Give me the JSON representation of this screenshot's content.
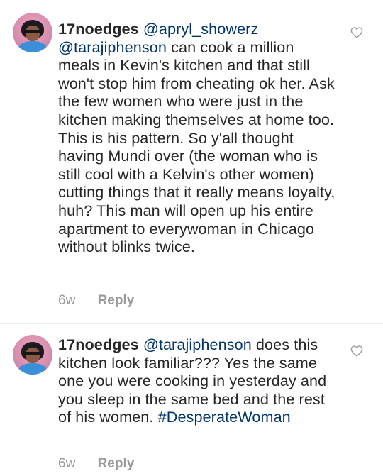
{
  "comments": [
    {
      "username": "17noedges",
      "mentions": [
        "@apryl_showerz",
        "@tarajiphenson"
      ],
      "body": "can cook a million meals in Kevin's kitchen and that still won't stop him from cheating ok her. Ask the few women who were just in the kitchen making themselves at home too. This is his pattern. So y'all thought having Mundi over (the woman who is still cool with a Kelvin's other women) cutting things that it really means loyalty, huh? This man will open up his entire apartment to everywoman in Chicago without blinks twice.",
      "time": "6w",
      "reply_label": "Reply",
      "like_icon": "heart-outline-icon"
    },
    {
      "username": "17noedges",
      "mentions": [
        "@tarajiphenson"
      ],
      "body": "does this kitchen look familiar??? Yes the same one you were cooking in yesterday and you sleep in the same bed and the rest of his women.",
      "hashtag": "#DesperateWoman",
      "time": "6w",
      "reply_label": "Reply",
      "like_icon": "heart-outline-icon"
    }
  ],
  "colors": {
    "text": "#262626",
    "link": "#003569",
    "meta": "#999999",
    "divider": "#ececec"
  }
}
